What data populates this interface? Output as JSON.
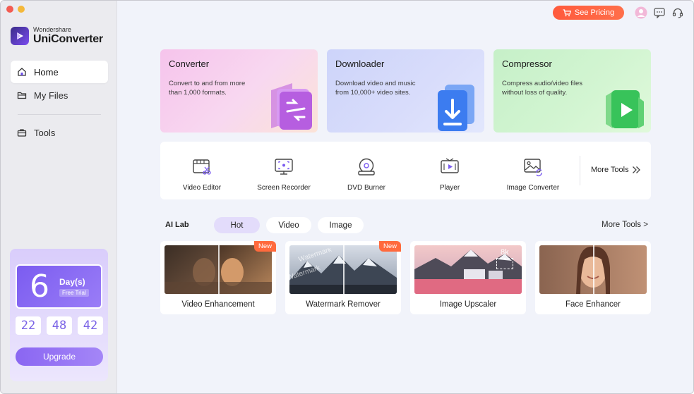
{
  "brand": {
    "small": "Wondershare",
    "name": "UniConverter"
  },
  "sidebar": {
    "items": [
      {
        "label": "Home",
        "icon": "home-icon",
        "active": true
      },
      {
        "label": "My Files",
        "icon": "folder-icon",
        "active": false
      },
      {
        "label": "Tools",
        "icon": "toolbox-icon",
        "active": false
      }
    ],
    "trial": {
      "days": "6",
      "days_label": "Day(s)",
      "free_label": "Free Trial",
      "countdown": [
        "22",
        "48",
        "42"
      ],
      "upgrade_label": "Upgrade"
    }
  },
  "topbar": {
    "pricing_label": "See Pricing"
  },
  "hero_cards": [
    {
      "title": "Converter",
      "desc": "Convert to and from more than 1,000 formats."
    },
    {
      "title": "Downloader",
      "desc": "Download video and music from 10,000+ video sites."
    },
    {
      "title": "Compressor",
      "desc": "Compress audio/video files without loss of quality."
    }
  ],
  "tools": [
    {
      "label": "Video Editor",
      "icon": "video-editor-icon"
    },
    {
      "label": "Screen Recorder",
      "icon": "screen-recorder-icon"
    },
    {
      "label": "DVD Burner",
      "icon": "dvd-burner-icon"
    },
    {
      "label": "Player",
      "icon": "player-icon"
    },
    {
      "label": "Image Converter",
      "icon": "image-converter-icon"
    }
  ],
  "more_tools_label": "More Tools",
  "ai_lab": {
    "title": "AI Lab",
    "tabs": [
      {
        "label": "Hot",
        "active": true
      },
      {
        "label": "Video",
        "active": false
      },
      {
        "label": "Image",
        "active": false
      }
    ],
    "more_label": "More Tools >",
    "cards": [
      {
        "label": "Video Enhancement",
        "badge": "New"
      },
      {
        "label": "Watermark Remover",
        "badge": "New",
        "watermark_text": "Watermark"
      },
      {
        "label": "Image Upscaler",
        "badge": "",
        "resolution": "8k"
      },
      {
        "label": "Face Enhancer",
        "badge": ""
      }
    ]
  },
  "colors": {
    "accent": "#7b5cf0",
    "pricing": "#ff5a3d",
    "new_badge": "#ff6a3d"
  }
}
